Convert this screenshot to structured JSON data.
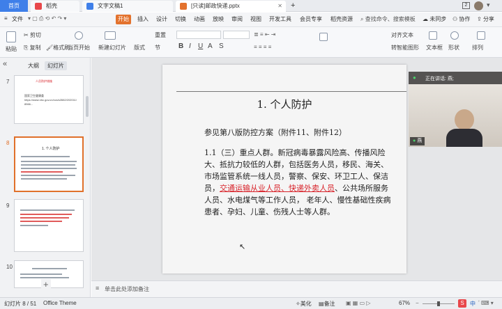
{
  "tabs": {
    "home": "首页",
    "wps": "稻壳",
    "doc": "文字文稿1",
    "ppt": "[只读]邮政快递.pptx",
    "add": "+",
    "page_indicator": "2"
  },
  "menu": {
    "file": "文件",
    "start": "开始",
    "insert": "插入",
    "design": "设计",
    "transition": "切换",
    "animation": "动画",
    "slideshow": "放映",
    "review": "审阅",
    "view": "视图",
    "devtools": "开发工具",
    "member": "会员专享",
    "resources": "稻壳资源",
    "search": "查找命令、搜索模板",
    "unsynced": "未同步",
    "collab": "协作",
    "share": "分享"
  },
  "ribbon": {
    "paste": "粘贴",
    "cut": "剪切",
    "copy": "复制",
    "format_painter": "格式刷",
    "from_current": "当页开始",
    "new_slide": "新建幻灯片",
    "layout": "版式",
    "section": "节",
    "reset": "重置",
    "textbox": "文本框",
    "shape": "形状",
    "arrange": "排列",
    "convert_smartart": "转智能图形",
    "align": "对齐文本"
  },
  "sidebar": {
    "outline_tab": "大纲",
    "slides_tab": "幻灯片",
    "collapse": "«",
    "add_button": "+",
    "thumbs": [
      {
        "num": "7",
        "title": "人员防护措施",
        "lines": [
          "国家卫生健康委",
          "https://www.nhc.gov.cn/xcs/s3582/202011/",
          "8566..."
        ]
      },
      {
        "num": "8",
        "title": "1. 个人防护",
        "lines": []
      },
      {
        "num": "9",
        "title": "",
        "lines": []
      },
      {
        "num": "10",
        "title": "",
        "lines": []
      }
    ]
  },
  "slide": {
    "title": "1. 个人防护",
    "subtitle": "参见第八版防控方案（附件11、附件12）",
    "body_pre": "1.1（三）重点人群。新冠病毒暴露风险高、传播风险大、抵抗力较低的人群，包括医务人员，移民、海关、市场监管系统一线人员，警察、保安、环卫工人、保洁员，",
    "body_highlight": "交通运输从业人员、快递外卖人员",
    "body_post": "、公共场所服务人员、水电煤气等工作人员，  老年人、慢性基础性疾病患者、孕妇、儿童、伤残人士等人群。"
  },
  "notes": {
    "placeholder": "单击此处添加备注"
  },
  "video": {
    "speaking": "正在讲话: 燕;",
    "name_tag": "燕"
  },
  "status": {
    "slide_pos": "幻灯片 8 / 51",
    "theme": "Office Theme",
    "beautify": "美化",
    "notes_btn": "备注",
    "zoom": "67%",
    "ime": "中"
  },
  "colors": {
    "accent_orange": "#e3722d",
    "home_blue": "#3f7fe9",
    "highlight_red": "#d8232a"
  }
}
